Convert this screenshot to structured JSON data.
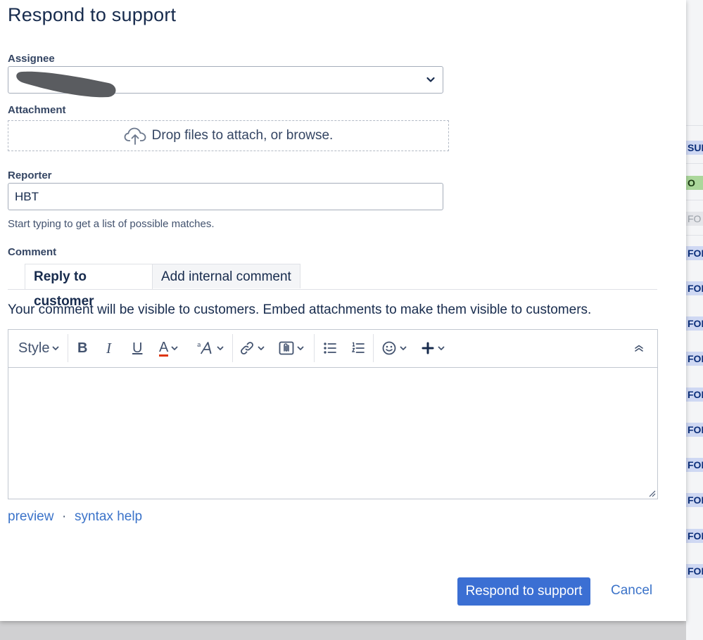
{
  "dialog": {
    "title": "Respond to support",
    "assignee_label": "Assignee",
    "attachment_label": "Attachment",
    "dropzone_text": "Drop files to attach, or browse.",
    "reporter_label": "Reporter",
    "reporter_value": "HBT",
    "reporter_hint": "Start typing to get a list of possible matches.",
    "comment_label": "Comment",
    "tabs": [
      {
        "label": "Reply to customer",
        "active": true
      },
      {
        "label": "Add internal comment",
        "active": false
      }
    ],
    "visibility_note": "Your comment will be visible to customers. Embed attachments to make them visible to customers.",
    "toolbar": {
      "style_label": "Style",
      "bold_label": "B",
      "italic_label": "I",
      "underline_label": "U",
      "text_color_label": "A",
      "text_color_accent": "#de350b"
    },
    "preview_link": "preview",
    "separator": "·",
    "syntax_help_link": "syntax help",
    "submit_label": "Respond to support",
    "cancel_label": "Cancel"
  },
  "background": {
    "tags": [
      {
        "text": "SUP",
        "variant": "blue"
      },
      {
        "text": "O",
        "variant": "green"
      },
      {
        "text": "FO",
        "variant": "grey"
      },
      {
        "text": "FOR",
        "variant": "blue"
      },
      {
        "text": "FOR",
        "variant": "blue"
      },
      {
        "text": "FOR",
        "variant": "blue"
      },
      {
        "text": "FOR",
        "variant": "blue"
      },
      {
        "text": "FOR",
        "variant": "blue"
      },
      {
        "text": "FOR",
        "variant": "blue"
      },
      {
        "text": "FOR",
        "variant": "blue"
      },
      {
        "text": "FOR",
        "variant": "blue"
      },
      {
        "text": "FOR",
        "variant": "blue"
      },
      {
        "text": "FOR",
        "variant": "blue"
      }
    ]
  }
}
